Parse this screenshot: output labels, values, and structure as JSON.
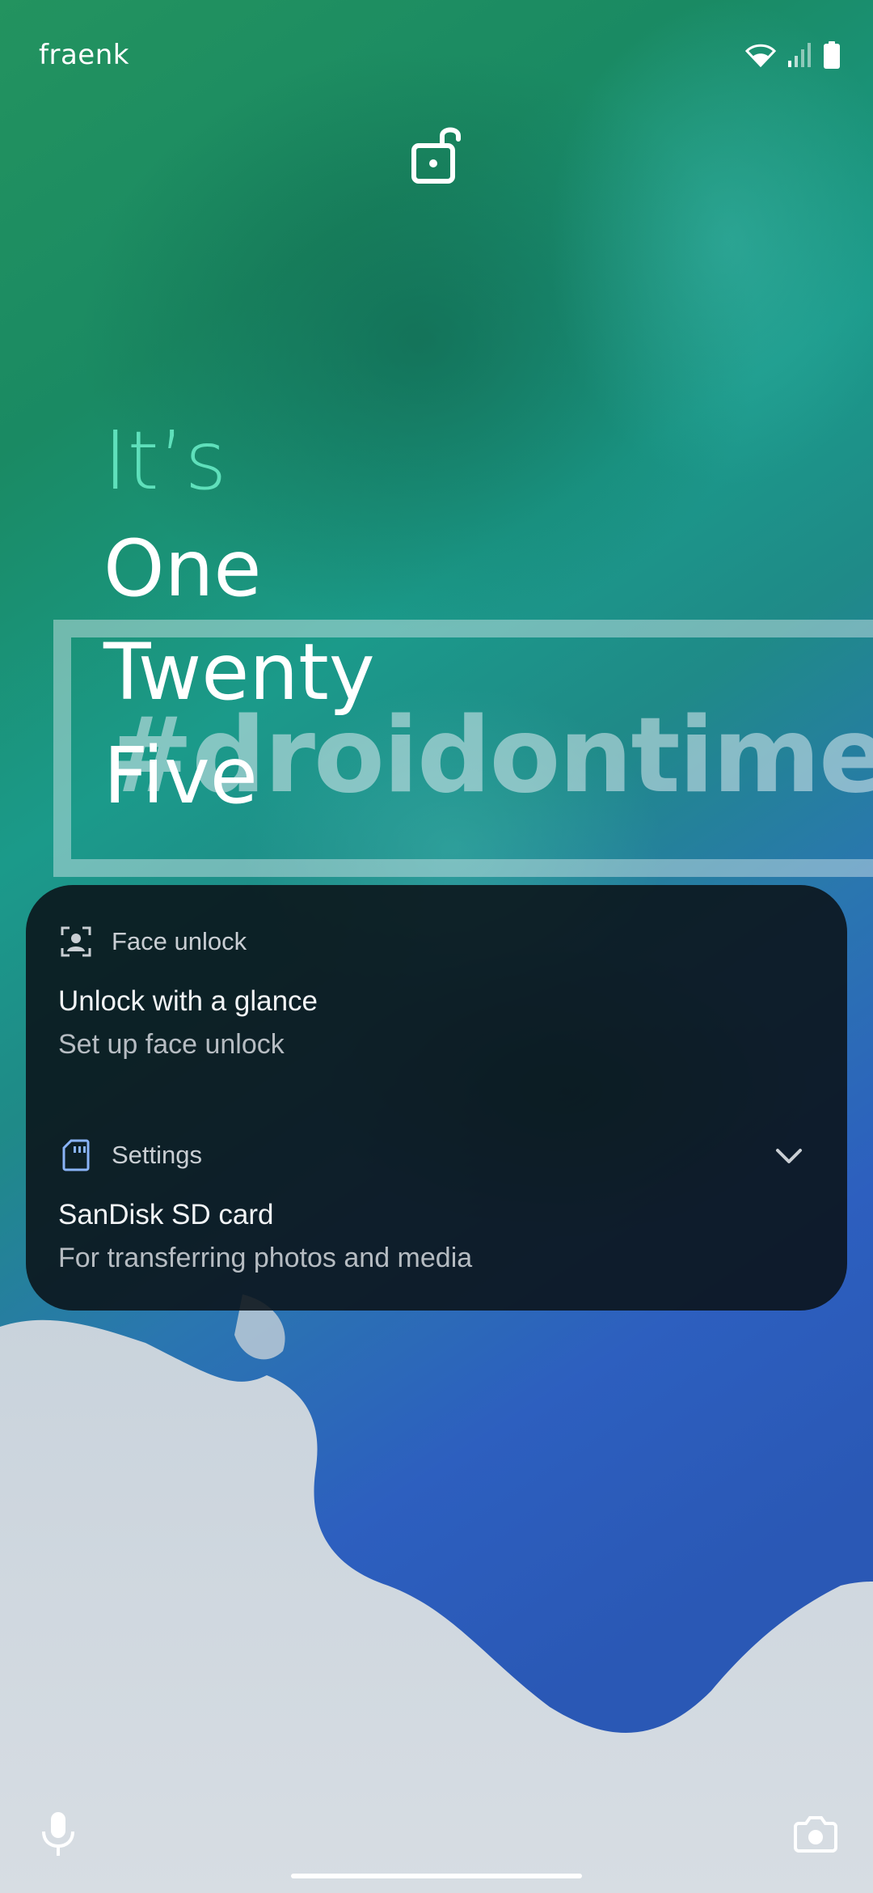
{
  "status_bar": {
    "carrier": "fraenk",
    "wifi_icon": "wifi-icon",
    "signal_icon": "signal-icon",
    "battery_icon": "battery-icon"
  },
  "lock_icon": "unlocked-padlock-icon",
  "clock": {
    "prefix": "It’s",
    "lines": [
      "One",
      "Twenty",
      "Five"
    ]
  },
  "watermark": {
    "hashtag": "#droidontime"
  },
  "notifications": [
    {
      "app_icon": "face-unlock-icon",
      "app_name": "Face unlock",
      "title": "Unlock with a glance",
      "text": "Set up face unlock"
    },
    {
      "app_icon": "sd-card-icon",
      "app_name": "Settings",
      "title": "SanDisk SD card",
      "text": "For transferring photos and media",
      "expand_icon": "chevron-down-icon"
    }
  ],
  "shortcuts": {
    "left": "microphone-icon",
    "right": "camera-icon"
  },
  "colors": {
    "clock_accent": "#5fe0bb",
    "notification_bg": "#0a1218",
    "settings_icon": "#8ab4f8"
  }
}
